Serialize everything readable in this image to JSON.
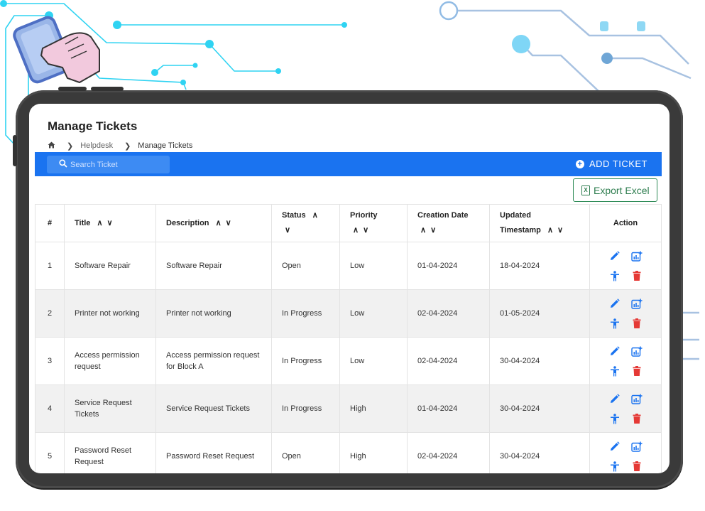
{
  "page": {
    "title": "Manage Tickets",
    "breadcrumb": [
      "Helpdesk",
      "Manage Tickets"
    ]
  },
  "toolbar": {
    "search_placeholder": "Search Ticket",
    "add_label": "ADD TICKET",
    "export_label": "Export Excel"
  },
  "table": {
    "headers": {
      "num": "#",
      "title": "Title",
      "description": "Description",
      "status": "Status",
      "priority": "Priority",
      "creation": "Creation Date",
      "updated_1": "Updated",
      "updated_2": "Timestamp",
      "action": "Action"
    },
    "rows": [
      {
        "num": "1",
        "title": "Software Repair",
        "description": "Software Repair",
        "status": "Open",
        "priority": "Low",
        "created": "01-04-2024",
        "updated": "18-04-2024"
      },
      {
        "num": "2",
        "title": "Printer not working",
        "description": "Printer not working",
        "status": "In Progress",
        "priority": "Low",
        "created": "02-04-2024",
        "updated": "01-05-2024"
      },
      {
        "num": "3",
        "title": "Access permission request",
        "description": "Access permission request for Block A",
        "status": "In Progress",
        "priority": "Low",
        "created": "02-04-2024",
        "updated": "30-04-2024"
      },
      {
        "num": "4",
        "title": "Service Request Tickets",
        "description": "Service Request Tickets",
        "status": "In Progress",
        "priority": "High",
        "created": "01-04-2024",
        "updated": "30-04-2024"
      },
      {
        "num": "5",
        "title": "Password Reset Request",
        "description": "Password Reset Request",
        "status": "Open",
        "priority": "High",
        "created": "02-04-2024",
        "updated": "30-04-2024"
      }
    ]
  },
  "colors": {
    "toolbar_blue": "#1a73f0",
    "export_green": "#2e7d4f",
    "edit_blue": "#1a73f0",
    "delete_red": "#e53935",
    "circuit_cyan": "#2fd3f2"
  },
  "icons": {
    "home": "home-icon",
    "search": "search-icon",
    "add": "add-circle-icon",
    "excel": "excel-icon",
    "edit": "pencil-icon",
    "report": "chart-add-icon",
    "assign": "person-icon",
    "delete": "trash-icon"
  }
}
